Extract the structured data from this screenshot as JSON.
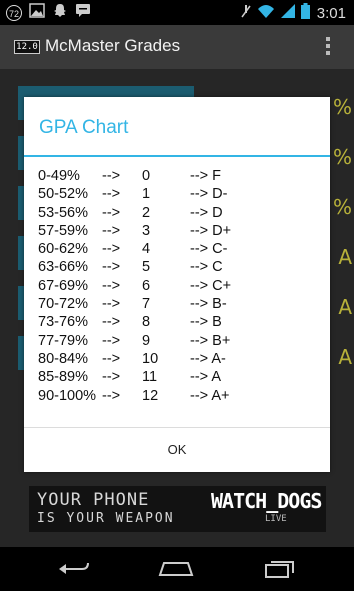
{
  "status_bar": {
    "badge": "72",
    "time": "3:01",
    "left_icons": [
      "notification-badge-icon",
      "gallery-icon",
      "snapchat-icon",
      "chat-icon"
    ],
    "right_icons": [
      "mute-icon",
      "wifi-icon",
      "signal-icon",
      "battery-icon"
    ]
  },
  "app_bar": {
    "icon_label": "12.0",
    "title": "McMaster Grades"
  },
  "background": {
    "percent_mark": "%",
    "grade_mark": "A"
  },
  "dialog": {
    "title": "GPA Chart",
    "rows": [
      {
        "range": "0-49%",
        "arrow1": "-->",
        "points": "0",
        "letter": "--> F"
      },
      {
        "range": "50-52%",
        "arrow1": "-->",
        "points": "1",
        "letter": "--> D-"
      },
      {
        "range": "53-56%",
        "arrow1": "-->",
        "points": "2",
        "letter": "--> D"
      },
      {
        "range": "57-59%",
        "arrow1": "-->",
        "points": "3",
        "letter": "--> D+"
      },
      {
        "range": "60-62%",
        "arrow1": "-->",
        "points": "4",
        "letter": "--> C-"
      },
      {
        "range": "63-66%",
        "arrow1": "-->",
        "points": "5",
        "letter": "--> C"
      },
      {
        "range": "67-69%",
        "arrow1": "-->",
        "points": "6",
        "letter": "--> C+"
      },
      {
        "range": "70-72%",
        "arrow1": "-->",
        "points": "7",
        "letter": "--> B-"
      },
      {
        "range": "73-76%",
        "arrow1": "-->",
        "points": "8",
        "letter": "--> B"
      },
      {
        "range": "77-79%",
        "arrow1": "-->",
        "points": "9",
        "letter": "--> B+"
      },
      {
        "range": "80-84%",
        "arrow1": "-->",
        "points": "10",
        "letter": "--> A-"
      },
      {
        "range": "85-89%",
        "arrow1": "-->",
        "points": "11",
        "letter": "--> A"
      },
      {
        "range": "90-100%",
        "arrow1": "-->",
        "points": "12",
        "letter": "--> A+"
      }
    ],
    "ok_label": "OK"
  },
  "ad": {
    "line1": "YOUR PHONE",
    "line2": "IS YOUR WEAPON",
    "brand": "WATCH_DOGS",
    "brand_sub": "LIVE"
  },
  "colors": {
    "accent": "#33b5e5",
    "tile": "#1b5c70",
    "grade_text": "#b7b13a"
  }
}
